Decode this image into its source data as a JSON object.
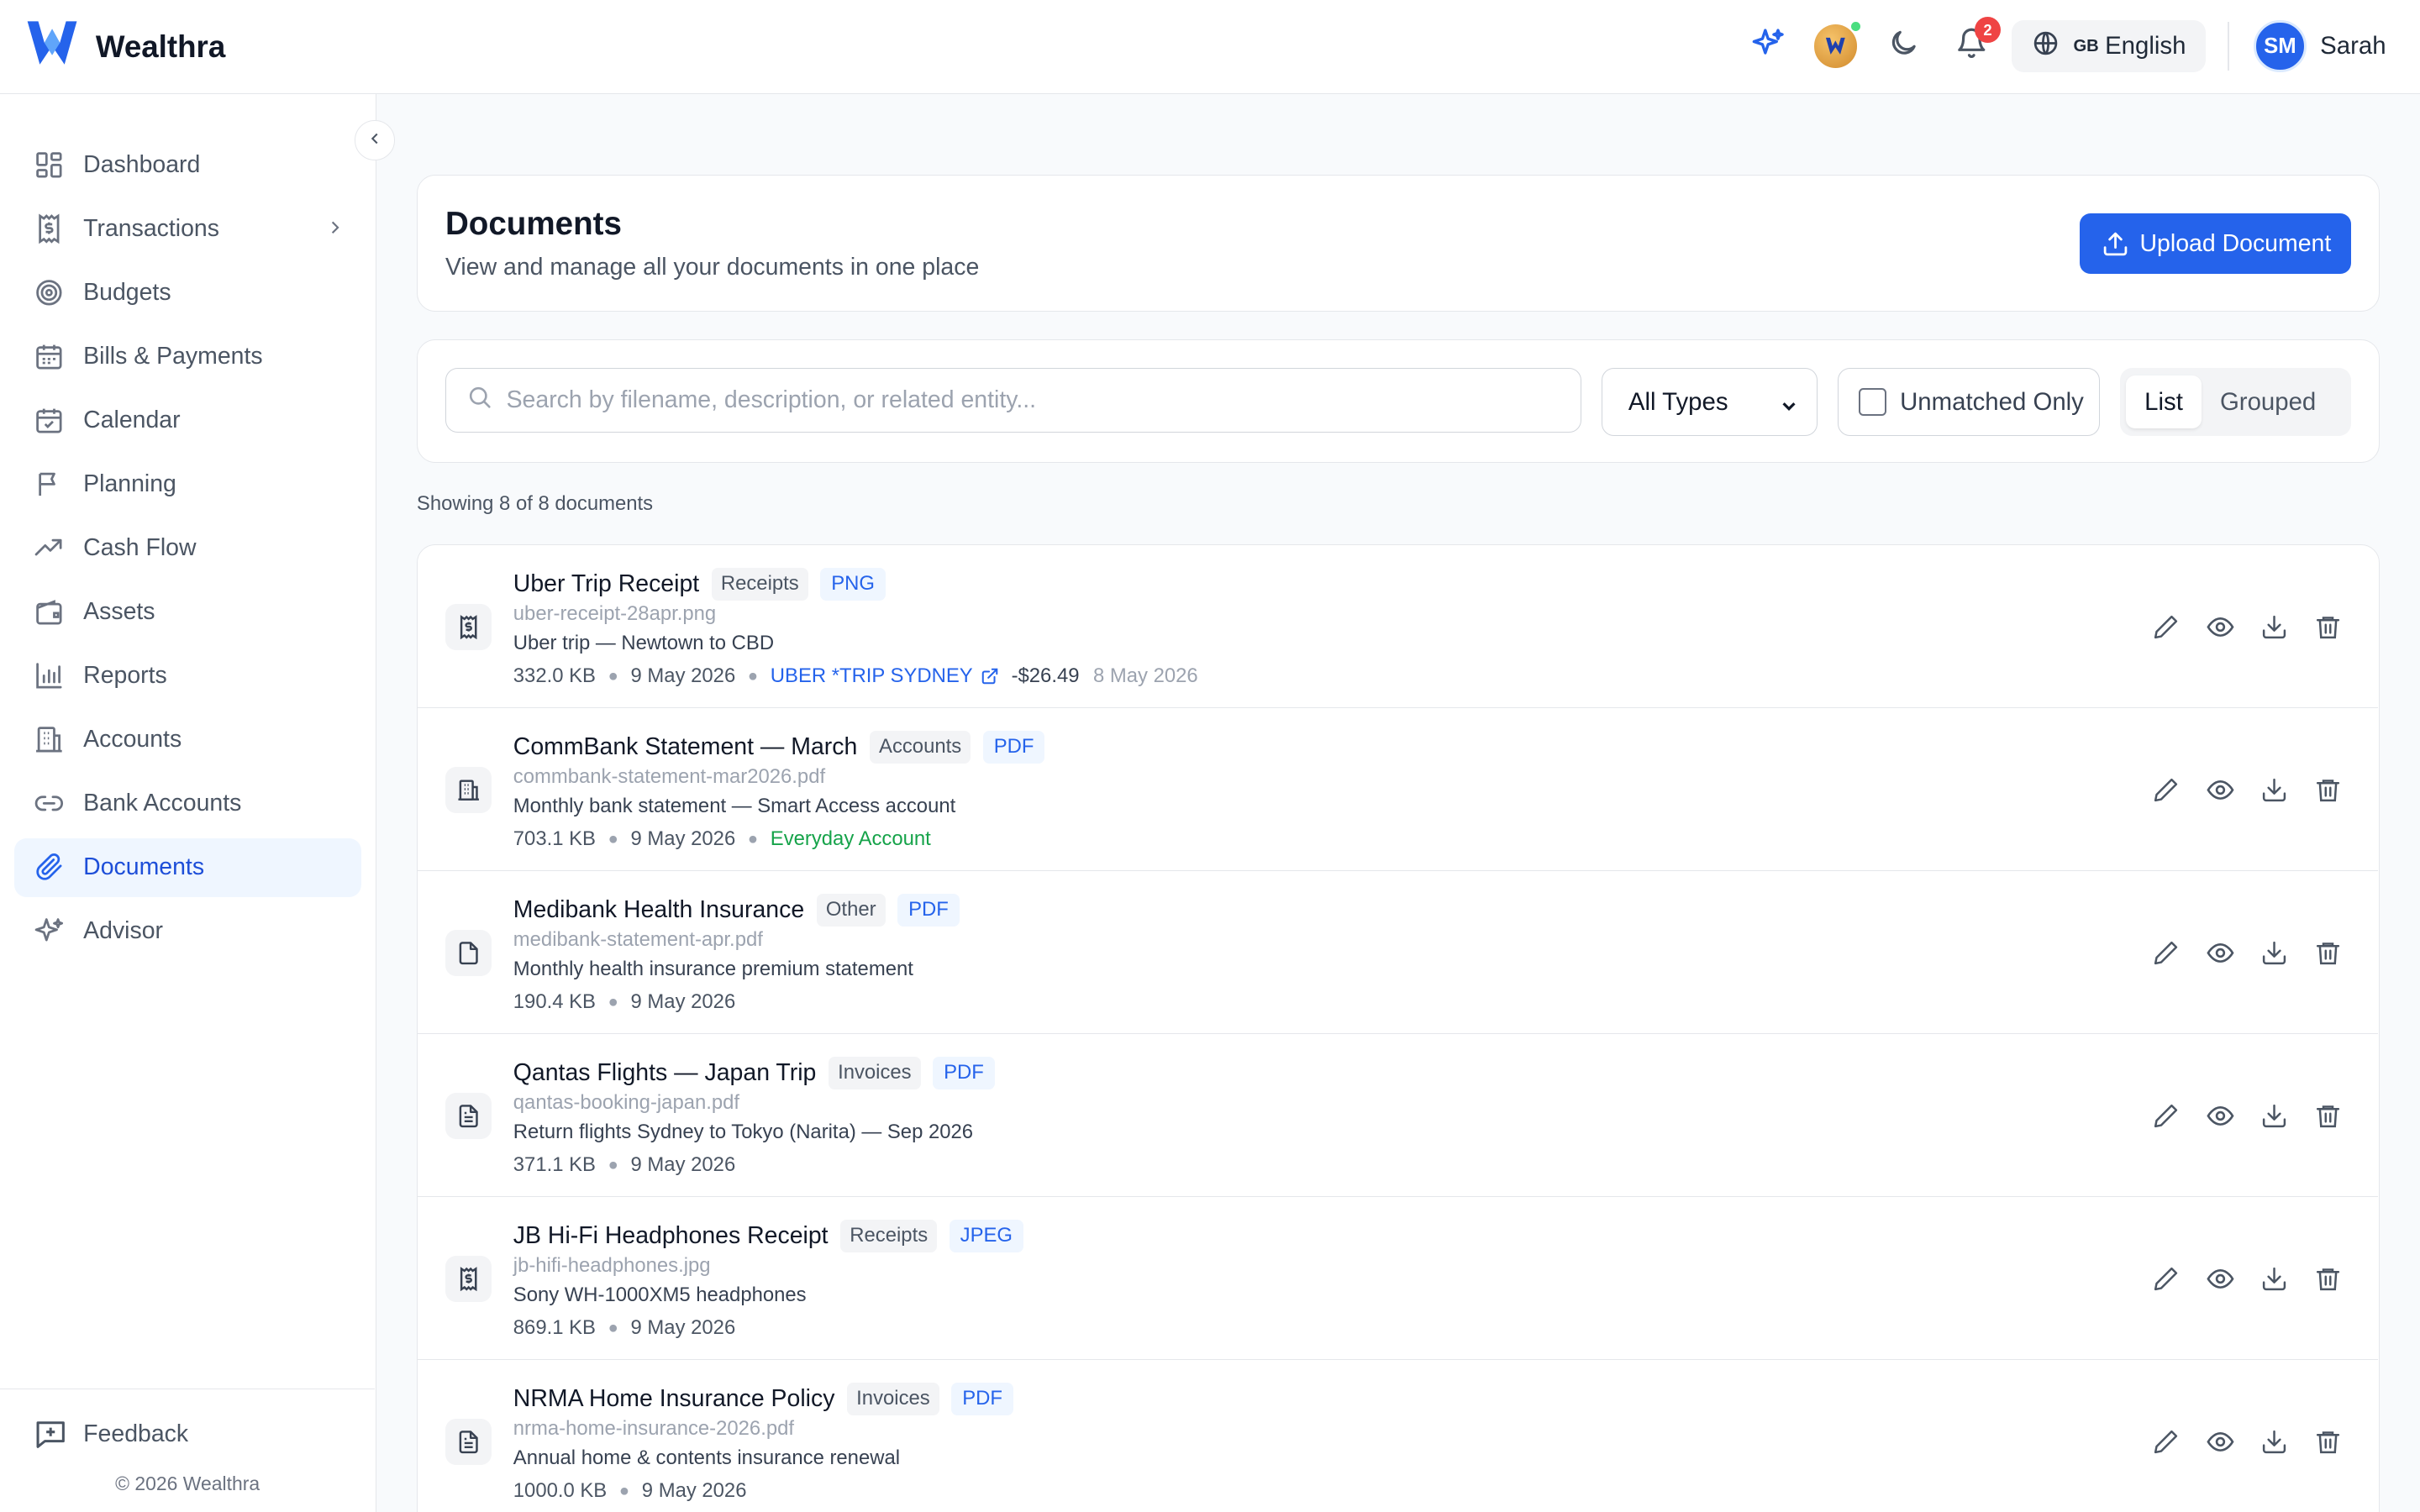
{
  "app": {
    "name": "Wealthra"
  },
  "header": {
    "language": {
      "flag": "GB",
      "label": "English"
    },
    "notifications_count": "2",
    "user": {
      "initials": "SM",
      "name": "Sarah"
    }
  },
  "sidebar": {
    "items": [
      {
        "label": "Dashboard",
        "icon": "dashboard-icon"
      },
      {
        "label": "Transactions",
        "icon": "receipt-dollar-icon",
        "has_submenu": true
      },
      {
        "label": "Budgets",
        "icon": "target-icon"
      },
      {
        "label": "Bills & Payments",
        "icon": "calendar-icon"
      },
      {
        "label": "Calendar",
        "icon": "calendar-check-icon"
      },
      {
        "label": "Planning",
        "icon": "flag-icon"
      },
      {
        "label": "Cash Flow",
        "icon": "trending-up-icon"
      },
      {
        "label": "Assets",
        "icon": "wallet-icon"
      },
      {
        "label": "Reports",
        "icon": "bar-chart-icon"
      },
      {
        "label": "Accounts",
        "icon": "building-icon"
      },
      {
        "label": "Bank Accounts",
        "icon": "link-icon"
      },
      {
        "label": "Documents",
        "icon": "paperclip-icon",
        "active": true
      },
      {
        "label": "Advisor",
        "icon": "sparkles-icon"
      }
    ],
    "feedback_label": "Feedback",
    "copyright": "© 2026 Wealthra"
  },
  "page": {
    "title": "Documents",
    "subtitle": "View and manage all your documents in one place",
    "upload_label": "Upload Document"
  },
  "filters": {
    "search_placeholder": "Search by filename, description, or related entity...",
    "type_selected": "All Types",
    "unmatched_label": "Unmatched Only",
    "unmatched_checked": false,
    "view_list": "List",
    "view_grouped": "Grouped",
    "view_active": "List"
  },
  "showing_text": "Showing 8 of 8 documents",
  "colors": {
    "accent": "#2563eb",
    "active_bg": "#eff6ff",
    "linked_account": "#16a34a"
  },
  "documents": [
    {
      "name": "Uber Trip Receipt",
      "category": "Receipts",
      "ext": "PNG",
      "filename": "uber-receipt-28apr.png",
      "description": "Uber trip — Newtown to CBD",
      "size": "332.0 KB",
      "date": "9 May 2026",
      "linked_transaction": "UBER *TRIP SYDNEY",
      "transaction_amount": "-$26.49",
      "transaction_date": "8 May 2026",
      "linked_account": "",
      "icon": "receipt-icon"
    },
    {
      "name": "CommBank Statement — March",
      "category": "Accounts",
      "ext": "PDF",
      "filename": "commbank-statement-mar2026.pdf",
      "description": "Monthly bank statement — Smart Access account",
      "size": "703.1 KB",
      "date": "9 May 2026",
      "linked_transaction": "",
      "transaction_amount": "",
      "transaction_date": "",
      "linked_account": "Everyday Account",
      "icon": "building-icon"
    },
    {
      "name": "Medibank Health Insurance",
      "category": "Other",
      "ext": "PDF",
      "filename": "medibank-statement-apr.pdf",
      "description": "Monthly health insurance premium statement",
      "size": "190.4 KB",
      "date": "9 May 2026",
      "linked_transaction": "",
      "transaction_amount": "",
      "transaction_date": "",
      "linked_account": "",
      "icon": "file-icon"
    },
    {
      "name": "Qantas Flights — Japan Trip",
      "category": "Invoices",
      "ext": "PDF",
      "filename": "qantas-booking-japan.pdf",
      "description": "Return flights Sydney to Tokyo (Narita) — Sep 2026",
      "size": "371.1 KB",
      "date": "9 May 2026",
      "linked_transaction": "",
      "transaction_amount": "",
      "transaction_date": "",
      "linked_account": "",
      "icon": "file-text-icon"
    },
    {
      "name": "JB Hi-Fi Headphones Receipt",
      "category": "Receipts",
      "ext": "JPEG",
      "filename": "jb-hifi-headphones.jpg",
      "description": "Sony WH-1000XM5 headphones",
      "size": "869.1 KB",
      "date": "9 May 2026",
      "linked_transaction": "",
      "transaction_amount": "",
      "transaction_date": "",
      "linked_account": "",
      "icon": "receipt-icon"
    },
    {
      "name": "NRMA Home Insurance Policy",
      "category": "Invoices",
      "ext": "PDF",
      "filename": "nrma-home-insurance-2026.pdf",
      "description": "Annual home & contents insurance renewal",
      "size": "1000.0 KB",
      "date": "9 May 2026",
      "linked_transaction": "",
      "transaction_amount": "",
      "transaction_date": "",
      "linked_account": "",
      "icon": "file-text-icon"
    }
  ]
}
